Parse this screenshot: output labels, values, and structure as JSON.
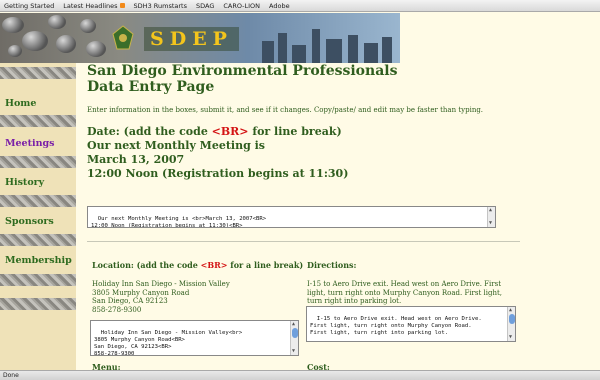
{
  "bookmarks": [
    "Getting Started",
    "Latest Headlines",
    "SDH3 Rumstarts",
    "SDAG",
    "CARO-LION",
    "Adobe"
  ],
  "banner": {
    "title": "SDEP"
  },
  "sidebar": {
    "items": [
      {
        "label": "Home"
      },
      {
        "label": "Meetings"
      },
      {
        "label": "History"
      },
      {
        "label": "Sponsors"
      },
      {
        "label": "Membership"
      }
    ]
  },
  "main": {
    "title_line1": "San Diego Environmental Professionals",
    "title_line2": "Data Entry Page",
    "intro": "Enter information in the boxes, submit it, and see if it changes. Copy/paste/ and edit may be faster than typing.",
    "date_label_prefix": "Date: (add the code ",
    "code_br": "<BR>",
    "date_label_suffix": " for line break)",
    "meeting_line1": "Our next Monthly Meeting is",
    "meeting_line2": "March 13, 2007",
    "meeting_line3": "12:00 Noon (Registration begins at 11:30)",
    "date_textarea": "Our next Monthly Meeting is <br>March 13, 2007<BR>\n12:00 Noon (Registration begins at 11:30)<BR>",
    "location_label_prefix": "Location: (add the code ",
    "location_label_suffix": " for a line break)",
    "location_line1": "Holiday Inn San Diego - Mission Valley",
    "location_line2": "3805 Murphy Canyon Road",
    "location_line3": "San Diego, CA 92123",
    "location_line4": "858-278-9300",
    "location_textarea": "Holiday Inn San Diego - Mission Valley<br>\n3805 Murphy Canyon Road<BR>\nSan Diego, CA 92123<BR>\n858-278-9300",
    "directions_label": "Directions:",
    "directions_text": "I-15 to Aero Drive exit. Head west on Aero Drive. First light, turn right onto Murphy Canyon Road. First light, turn right into parking lot.",
    "directions_textarea": "I-15 to Aero Drive exit. Head west on Aero Drive.\nFirst light, turn right onto Murphy Canyon Road.\nFirst light, turn right into parking lot.",
    "menu_label": "Menu:",
    "cost_label": "Cost:"
  },
  "status_bar": {
    "text": "Done"
  },
  "colors": {
    "heading_green": "#2f5d1e",
    "code_red": "#d41414",
    "nav_active": "#7a1fa8",
    "banner_title": "#f4c51c"
  }
}
